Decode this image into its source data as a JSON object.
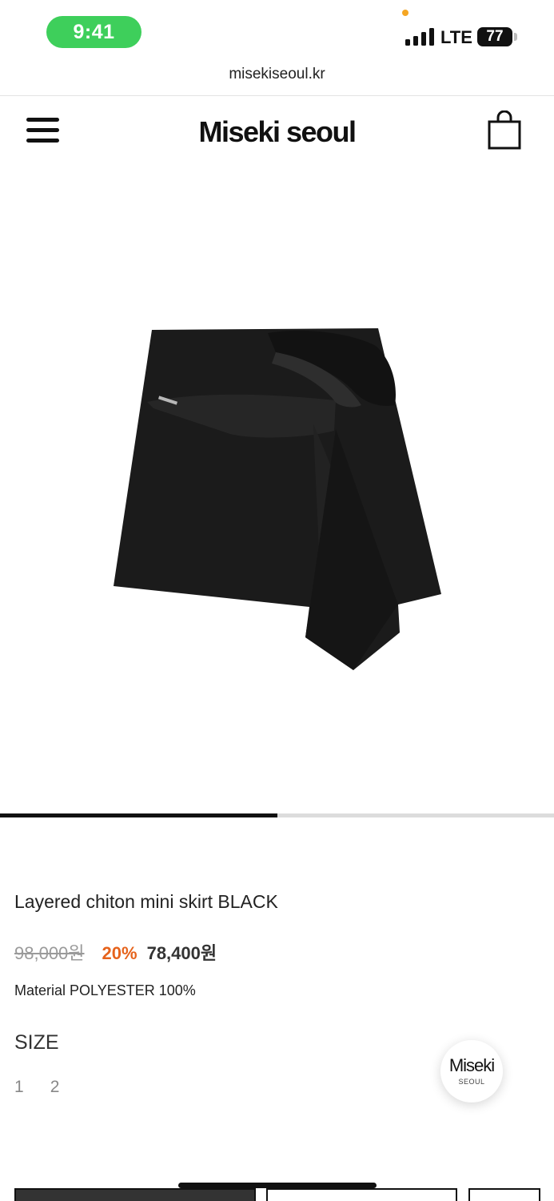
{
  "status_bar": {
    "time": "9:41",
    "network": "LTE",
    "battery": "77"
  },
  "browser": {
    "url": "misekiseoul.kr"
  },
  "header": {
    "brand": "Miseki seoul"
  },
  "gallery": {
    "progress": 0.5
  },
  "product": {
    "title": "Layered chiton mini skirt BLACK",
    "price_original": "98,000원",
    "discount": "20%",
    "price_sale": "78,400원",
    "material": "Material POLYESTER 100%"
  },
  "size": {
    "heading": "SIZE",
    "options": [
      "1",
      "2"
    ]
  },
  "floating_badge": {
    "brand": "Miseki",
    "sub": "SEOUL"
  },
  "colors": {
    "discount": "#e6631c",
    "time_pill": "#3ecf5b",
    "privacy_dot": "#f5a623"
  },
  "icons": [
    "signal-icon",
    "battery-icon",
    "menu-icon",
    "shopping-bag-icon"
  ]
}
